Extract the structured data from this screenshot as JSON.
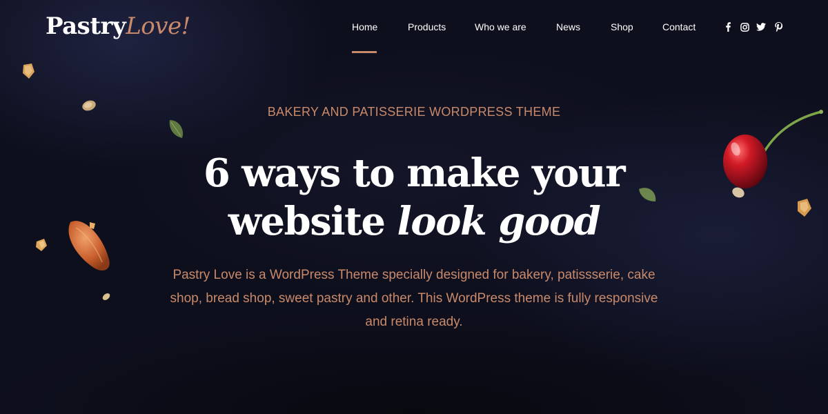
{
  "brand": {
    "name_part1": "Pastry",
    "name_part2": "Love",
    "name_part3": "!"
  },
  "nav": {
    "items": [
      {
        "label": "Home",
        "active": true
      },
      {
        "label": "Products",
        "active": false
      },
      {
        "label": "Who we are",
        "active": false
      },
      {
        "label": "News",
        "active": false
      },
      {
        "label": "Shop",
        "active": false
      },
      {
        "label": "Contact",
        "active": false
      }
    ],
    "social": [
      "facebook-icon",
      "instagram-icon",
      "twitter-icon",
      "pinterest-icon"
    ]
  },
  "hero": {
    "eyebrow": "BAKERY AND PATISSERIE WORDPRESS THEME",
    "headline_line1": "6 ways to make your",
    "headline_line2_plain": "website ",
    "headline_line2_italic": "look good",
    "description": "Pastry Love is a WordPress Theme specially designed for bakery, patissserie, cake shop, bread shop, sweet pastry and other. This WordPress theme is fully responsive and retina ready."
  },
  "colors": {
    "accent": "#c98a6b",
    "background": "#0e0f1d",
    "text": "#ffffff"
  }
}
